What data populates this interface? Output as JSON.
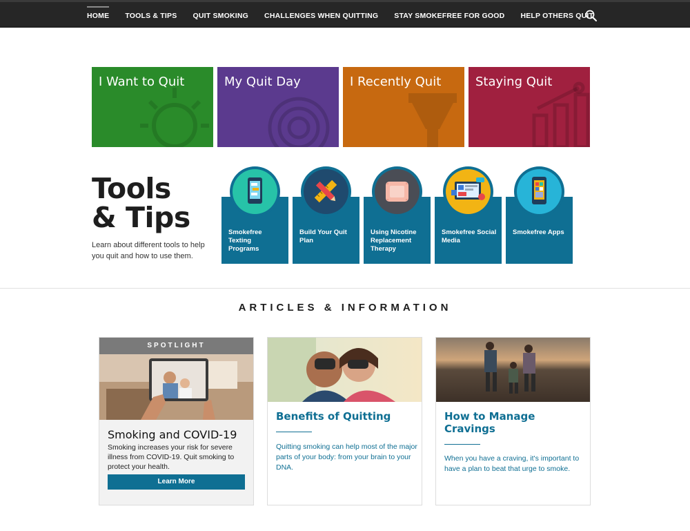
{
  "nav": {
    "items": [
      {
        "label": "HOME",
        "active": true
      },
      {
        "label": "TOOLS & TIPS"
      },
      {
        "label": "QUIT SMOKING"
      },
      {
        "label": "CHALLENGES WHEN QUITTING"
      },
      {
        "label": "STAY SMOKEFREE FOR GOOD"
      },
      {
        "label": "HELP OTHERS QUIT"
      }
    ],
    "search_icon": "search-icon"
  },
  "quit_tiles": [
    {
      "label": "I Want to Quit",
      "color": "#2a8b2a",
      "icon": "lightbulb-icon"
    },
    {
      "label": "My Quit Day",
      "color": "#5b3a8e",
      "icon": "target-icon"
    },
    {
      "label": "I Recently Quit",
      "color": "#c76910",
      "icon": "trophy-icon"
    },
    {
      "label": "Staying Quit",
      "color": "#a0203f",
      "icon": "chart-icon"
    }
  ],
  "tools": {
    "title_line1": "Tools",
    "title_line2": "& Tips",
    "description": "Learn about different tools to help you quit and how to use them.",
    "cards": [
      {
        "label": "Smokefree Texting Programs",
        "icon": "phone-chat-icon",
        "circle_color": "#27c3a8"
      },
      {
        "label": "Build Your Quit Plan",
        "icon": "pencil-ruler-icon",
        "circle_color": "#1f4a6e"
      },
      {
        "label": "Using Nicotine Replacement Therapy",
        "icon": "patch-icon",
        "circle_color": "#4a4d55"
      },
      {
        "label": "Smokefree Social Media",
        "icon": "social-media-icon",
        "circle_color": "#f2b414"
      },
      {
        "label": "Smokefree Apps",
        "icon": "phone-app-icon",
        "circle_color": "#27b4d8"
      }
    ]
  },
  "articles": {
    "heading": "ARTICLES & INFORMATION",
    "spotlight": {
      "tag": "SPOTLIGHT",
      "title": "Smoking and COVID-19",
      "body": "Smoking increases your risk for severe illness from COVID-19. Quit smoking to protect your health.",
      "button": "Learn More"
    },
    "cards": [
      {
        "title": "Benefits of Quitting",
        "body": "Quitting smoking can help most of the major parts of your body: from your brain to your DNA."
      },
      {
        "title": "How to Manage Cravings",
        "body": "When you have a craving, it's important to have a plan to beat that urge to smoke."
      }
    ]
  }
}
